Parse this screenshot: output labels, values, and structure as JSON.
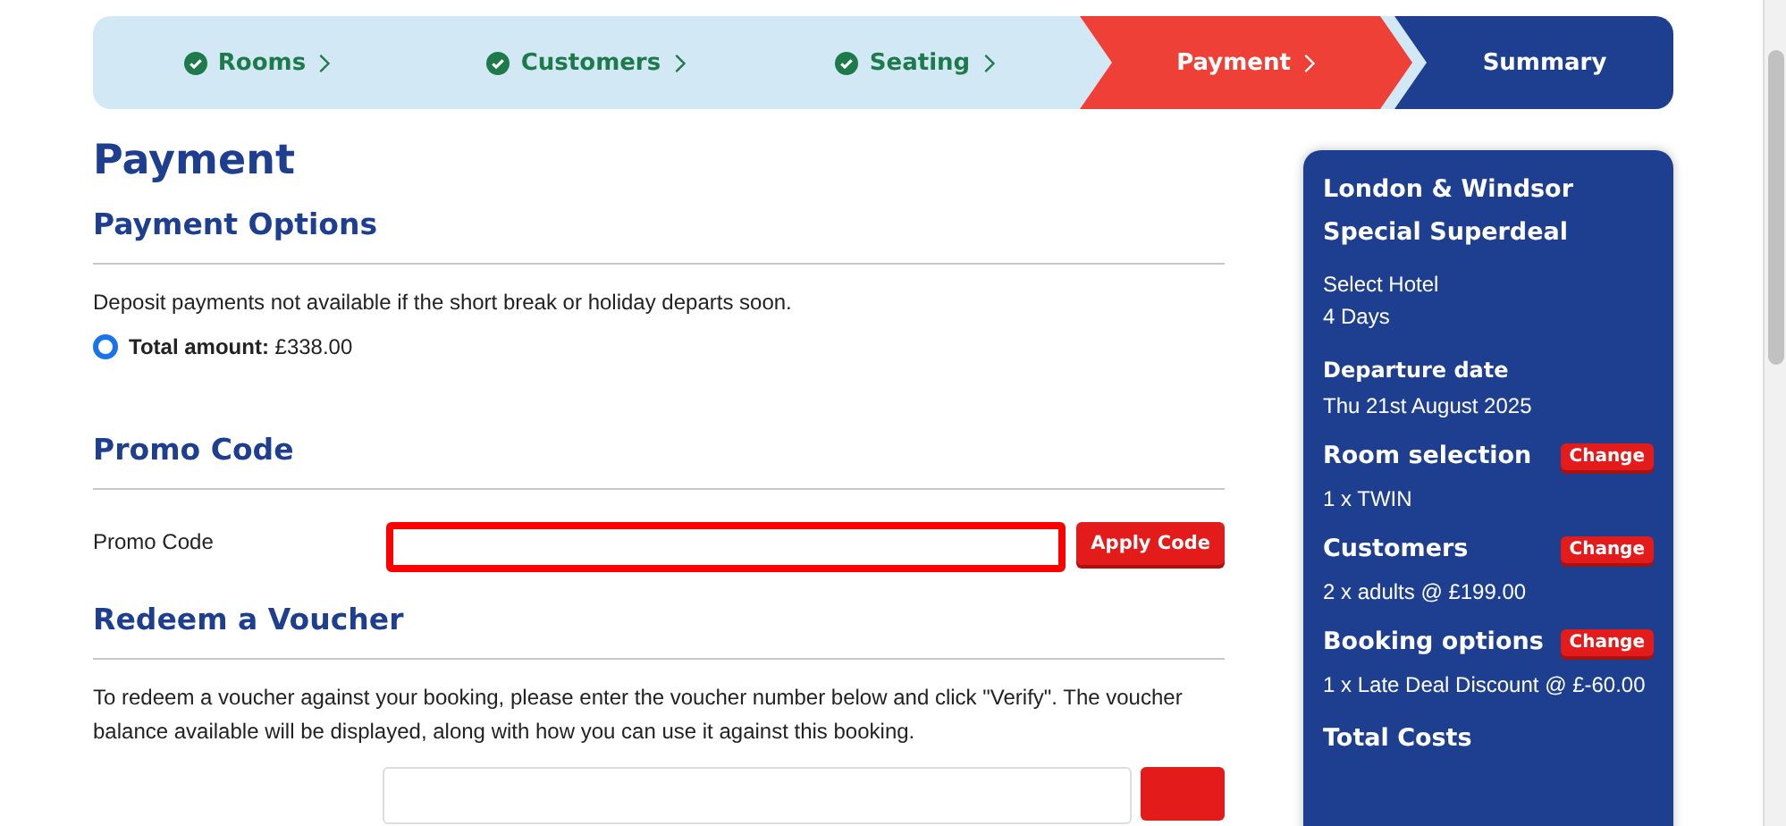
{
  "steps": [
    {
      "label": "Rooms",
      "done": true,
      "selected": false
    },
    {
      "label": "Customers",
      "done": true,
      "selected": false
    },
    {
      "label": "Seating",
      "done": true,
      "selected": false
    },
    {
      "label": "Payment",
      "done": false,
      "selected": true
    },
    {
      "label": "Summary",
      "done": false,
      "selected": false
    }
  ],
  "page_title": "Payment",
  "payment_options": {
    "heading": "Payment Options",
    "note": "Deposit payments not available if the short break or holiday departs soon.",
    "options": [
      {
        "label": "Total amount:",
        "amount": "£338.00",
        "selected": true
      }
    ]
  },
  "promo": {
    "heading": "Promo Code",
    "label": "Promo Code",
    "button": "Apply Code"
  },
  "voucher": {
    "heading": "Redeem a Voucher",
    "text": "To redeem a voucher against your booking, please enter the voucher number below and click \"Verify\". The voucher balance available will be displayed, along with how you can use it against this booking."
  },
  "summary": {
    "title": "London & Windsor Special Superdeal",
    "details": [
      "Select Hotel",
      "4 Days"
    ],
    "sections": [
      {
        "kind": "info",
        "heading": "Departure date",
        "value": "Thu 21st August 2025"
      },
      {
        "kind": "editable",
        "heading": "Room selection",
        "value": "1 x TWIN",
        "action": "Change"
      },
      {
        "kind": "editable",
        "heading": "Customers",
        "value": "2 x adults @ £199.00",
        "action": "Change"
      },
      {
        "kind": "editable",
        "heading": "Booking options",
        "value": "1 x Late Deal Discount @ £-60.00",
        "action": "Change"
      }
    ],
    "totals_heading": "Total Costs"
  }
}
